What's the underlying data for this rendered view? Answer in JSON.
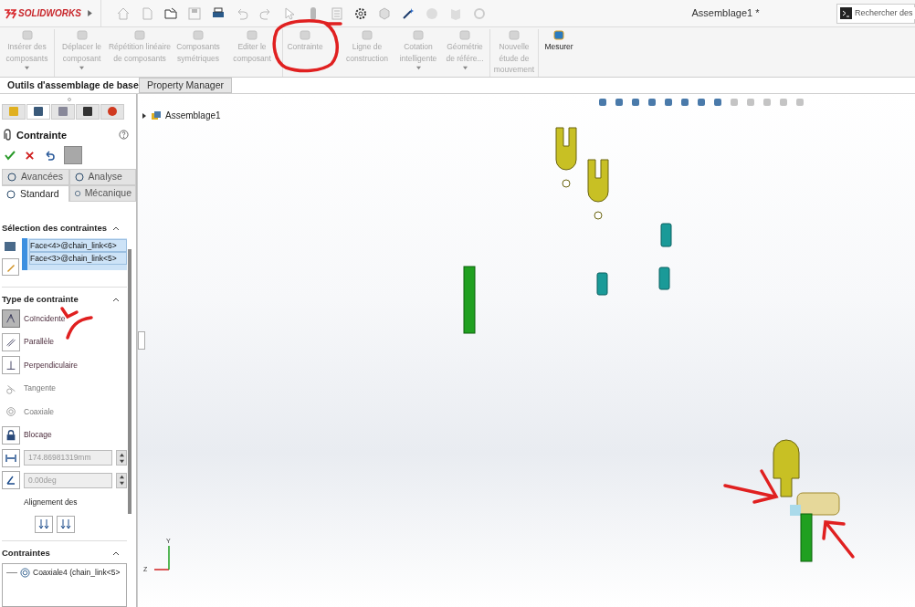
{
  "app": {
    "logo": "SOLIDWORKS",
    "title": "Assemblage1 *",
    "search_placeholder": "Rechercher des"
  },
  "ribbon": [
    {
      "label": "Insérer des\ncomposants",
      "disabled": true,
      "dropdown": true
    },
    {
      "label": "Déplacer le\ncomposant",
      "disabled": true,
      "dropdown": true
    },
    {
      "label": "Répétition linéaire\nde composants",
      "disabled": true,
      "dropdown": false
    },
    {
      "label": "Composants\nsymétriques",
      "disabled": true,
      "dropdown": false
    },
    {
      "label": "Editer le\ncomposant",
      "disabled": true,
      "dropdown": false
    },
    {
      "label": "Contrainte",
      "disabled": true,
      "dropdown": false
    },
    {
      "label": "Ligne de\nconstruction",
      "disabled": true,
      "dropdown": false
    },
    {
      "label": "Cotation\nintelligente",
      "disabled": true,
      "dropdown": true
    },
    {
      "label": "Géométrie\nde référe...",
      "disabled": true,
      "dropdown": true
    },
    {
      "label": "Nouvelle\nétude de\nmouvement",
      "disabled": true,
      "dropdown": false
    },
    {
      "label": "Mesurer",
      "disabled": false,
      "dropdown": false
    }
  ],
  "tabs": [
    {
      "label": "Outils d'assemblage de base",
      "selected": true
    },
    {
      "label": "Property Manager",
      "selected": false
    }
  ],
  "property_manager": {
    "manager_tabs": [
      {
        "selected": false
      },
      {
        "selected": true
      },
      {
        "selected": false
      },
      {
        "selected": false
      },
      {
        "selected": false
      }
    ],
    "title": "Contrainte",
    "subtabs": [
      {
        "label": "Avancées",
        "selected": false
      },
      {
        "label": "Analyse",
        "selected": false
      },
      {
        "label": "Standard",
        "selected": true
      },
      {
        "label": "Mécanique",
        "selected": false
      }
    ],
    "selection_heading": "Sélection des contraintes",
    "selections": [
      "Face<4>@chain_link<6>",
      "Face<3>@chain_link<5>"
    ],
    "type_heading": "Type de contrainte",
    "types": [
      {
        "label": "Coïncidente",
        "kind": "button",
        "selected": true
      },
      {
        "label": "Parallèle",
        "kind": "button",
        "selected": false
      },
      {
        "label": "Perpendiculaire",
        "kind": "button",
        "selected": false
      },
      {
        "label": "Tangente",
        "kind": "plain",
        "selected": false
      },
      {
        "label": "Coaxiale",
        "kind": "plain",
        "selected": false
      },
      {
        "label": "Blocage",
        "kind": "button",
        "selected": false
      }
    ],
    "distance": {
      "value": "174.86981319mm",
      "disabled": true
    },
    "angle": {
      "value": "0.00deg",
      "disabled": true
    },
    "alignment_label": "Alignement des",
    "mates_heading": "Contraintes",
    "mates": [
      "Coaxiale4 (chain_link<5>"
    ]
  },
  "tree": {
    "root": "Assemblage1"
  },
  "triad": {
    "y": "Y",
    "z": "Z"
  }
}
